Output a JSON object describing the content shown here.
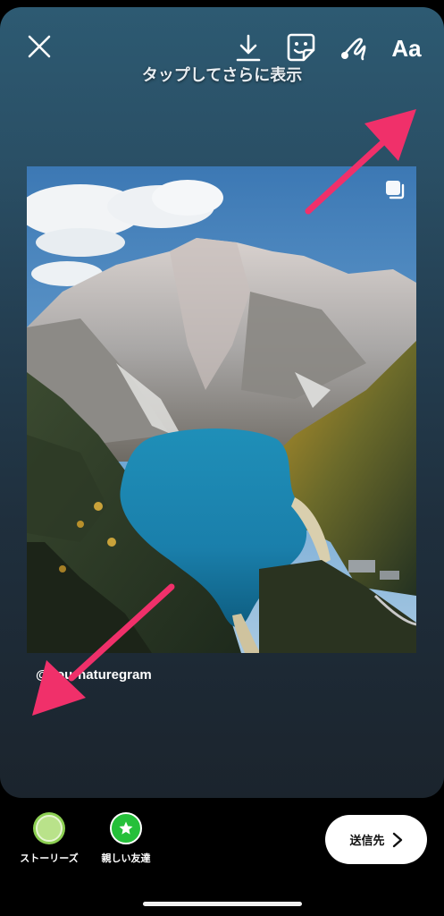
{
  "toolbar": {
    "close_icon": "close-icon",
    "download_icon": "download-icon",
    "sticker_icon": "sticker-icon",
    "draw_icon": "draw-squiggle-icon",
    "text_label": "Aa"
  },
  "hint": "タップしてさらに表示",
  "post": {
    "username": "@yournaturegram",
    "image_description": "mountain-lake-aerial-photo",
    "multi_photo_icon": "carousel-icon"
  },
  "annotations": {
    "arrow_color": "#f0306a"
  },
  "share": {
    "stories_label": "ストーリーズ",
    "close_friends_label": "親しい友達",
    "close_friends_color": "#25c03a",
    "send_label": "送信先"
  },
  "colors": {
    "accent_pink": "#f0306a",
    "green": "#25c03a"
  }
}
